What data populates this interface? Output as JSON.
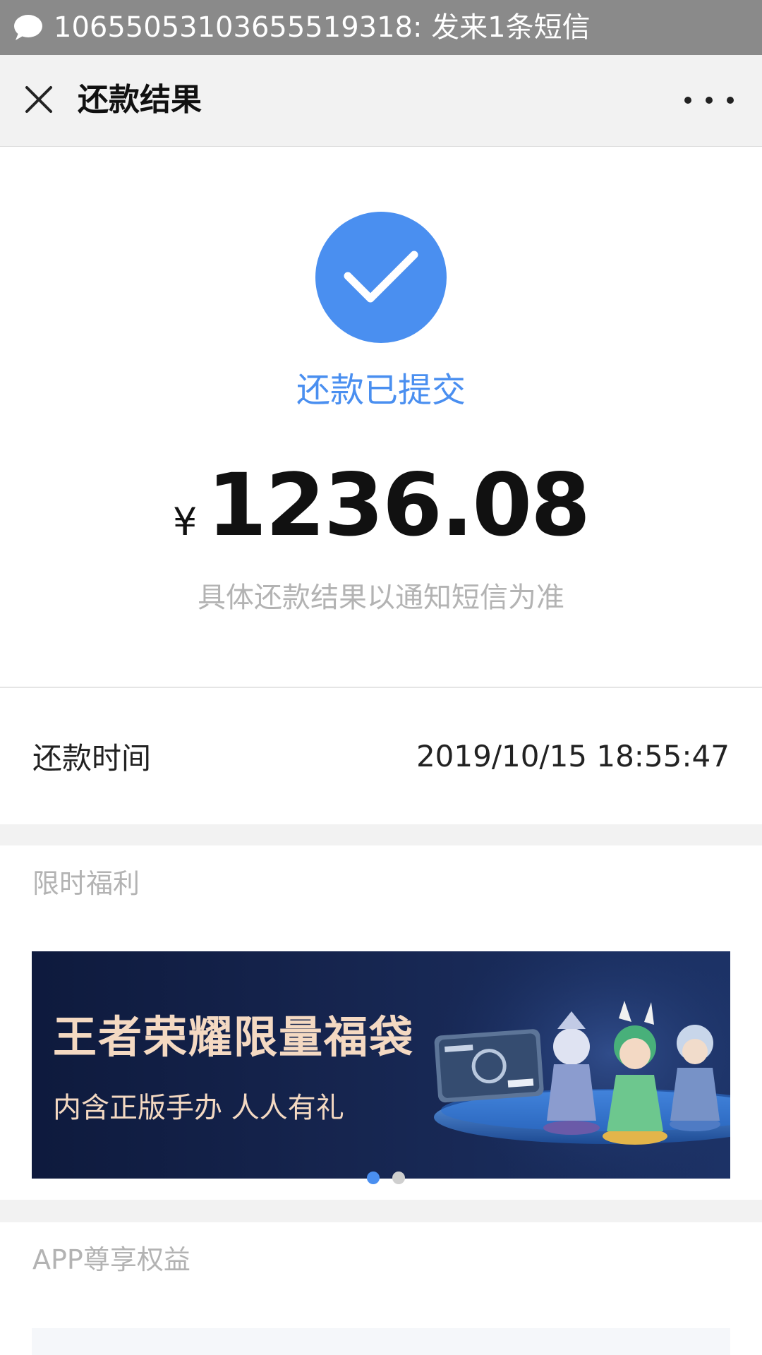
{
  "status_bar": {
    "notification_text": "10655053103655519318: 发来1条短信",
    "icon": "message-bubble-icon"
  },
  "nav": {
    "title": "还款结果",
    "close_icon": "close-icon",
    "more_icon": "more-icon"
  },
  "result": {
    "status": "还款已提交",
    "currency": "¥",
    "amount": "1236.08",
    "note": "具体还款结果以通知短信为准",
    "icon": "check-circle-icon",
    "accent_color": "#4a8ff0"
  },
  "details": {
    "time_label": "还款时间",
    "time_value": "2019/10/15 18:55:47"
  },
  "promo": {
    "section_title": "限时福利",
    "banner_title": "王者荣耀限量福袋",
    "banner_subtitle": "内含正版手办 人人有礼",
    "carousel_total": 2,
    "carousel_active": 1
  },
  "app_benefits": {
    "section_title": "APP尊享权益"
  }
}
